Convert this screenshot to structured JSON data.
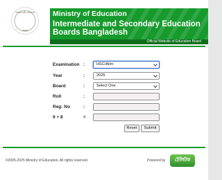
{
  "header": {
    "logo_top_text": "গণপ্রজাতন্ত্রী বাংলাদেশ",
    "logo_bottom_text": "সরকার",
    "ministry": "Ministry of Education",
    "board_title": "Intermediate and Secondary Education Boards Bangladesh",
    "website_tag": "Official Website of Education Board"
  },
  "form": {
    "labels": {
      "examination": "Examination",
      "year": "Year",
      "board": "Board",
      "roll": "Roll",
      "reg_no": "Reg: No",
      "captcha": "9 + 8"
    },
    "colon": ":",
    "equals": "=",
    "values": {
      "examination": "HSC/Alim",
      "year": "2025",
      "board": "Select One",
      "roll": "",
      "reg_no": "",
      "captcha_answer": ""
    },
    "buttons": {
      "reset": "Reset",
      "submit": "Submit"
    }
  },
  "footer": {
    "copyright": "©2005-2025 Ministry of Education, All rights reserved.",
    "powered_by": "Powered by",
    "powered_logo": "টেলিটক"
  },
  "colors": {
    "banner_green": "#159a2b",
    "banner_dark_green": "#0d6e1c",
    "field_bg": "#f4f0f2"
  }
}
